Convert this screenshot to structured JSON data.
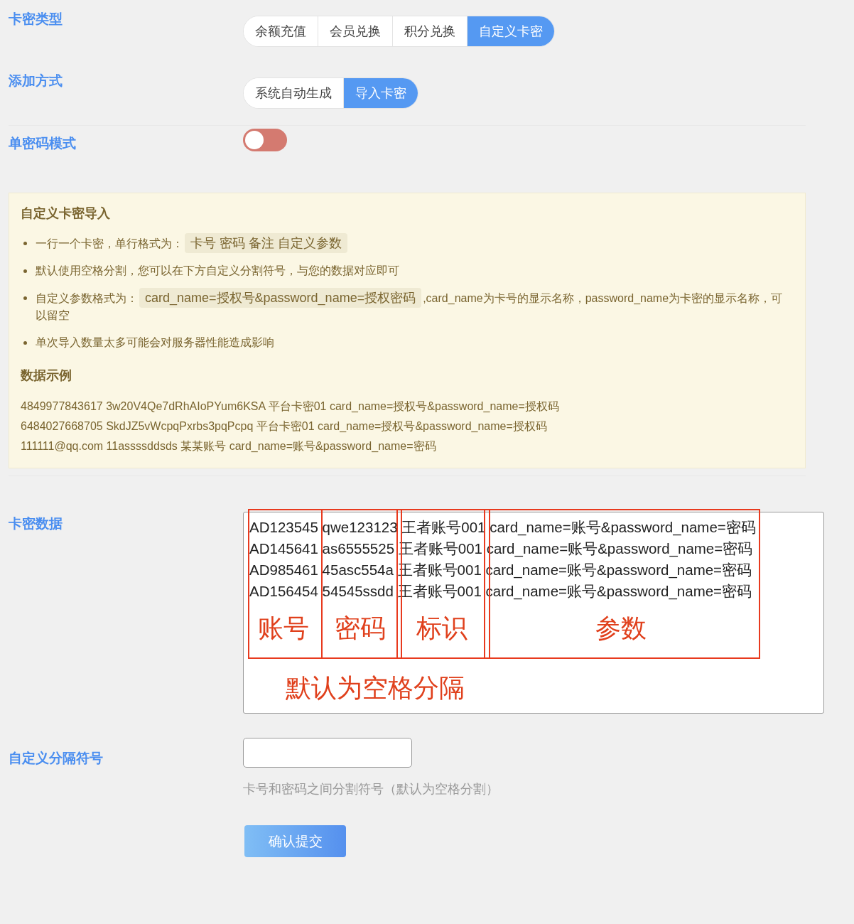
{
  "card_type": {
    "label": "卡密类型",
    "options": [
      {
        "label": "余额充值",
        "selected": false
      },
      {
        "label": "会员兑换",
        "selected": false
      },
      {
        "label": "积分兑换",
        "selected": false
      },
      {
        "label": "自定义卡密",
        "selected": true
      }
    ]
  },
  "add_method": {
    "label": "添加方式",
    "options": [
      {
        "label": "系统自动生成",
        "selected": false
      },
      {
        "label": "导入卡密",
        "selected": true
      }
    ]
  },
  "single_password_mode": {
    "label": "单密码模式",
    "on": false
  },
  "tips": {
    "title": "自定义卡密导入",
    "items": [
      [
        {
          "kind": "text",
          "text": "一行一个卡密，单行格式为："
        },
        {
          "kind": "code",
          "text": "卡号  密码  备注  自定义参数"
        }
      ],
      [
        {
          "kind": "text",
          "text": "默认使用空格分割，您可以在下方自定义分割符号，与您的数据对应即可"
        }
      ],
      [
        {
          "kind": "text",
          "text": "自定义参数格式为："
        },
        {
          "kind": "code",
          "text": "card_name=授权号&password_name=授权密码"
        },
        {
          "kind": "text",
          "text": ",card_name为卡号的显示名称，password_name为卡密的显示名称，可以留空"
        }
      ],
      [
        {
          "kind": "text",
          "text": "单次导入数量太多可能会对服务器性能造成影响"
        }
      ]
    ],
    "example_title": "数据示例",
    "examples": [
      "4849977843617 3w20V4Qe7dRhAIoPYum6KSA 平台卡密01 card_name=授权号&password_name=授权码",
      "6484027668705 SkdJZ5vWcpqPxrbs3pqPcpq 平台卡密01 card_name=授权号&password_name=授权码",
      "111111@qq.com 11assssddsds 某某账号 card_name=账号&password_name=密码"
    ]
  },
  "card_data": {
    "label": "卡密数据",
    "lines": [
      "AD123545 qwe123123 王者账号001 card_name=账号&password_name=密码",
      "AD145641 as6555525 王者账号001 card_name=账号&password_name=密码",
      "AD985461 45asc554a 王者账号001 card_name=账号&password_name=密码",
      "AD156454 54545ssdd 王者账号001 card_name=账号&password_name=密码"
    ],
    "annotations": [
      {
        "label": "账号"
      },
      {
        "label": "密码"
      },
      {
        "label": "标识"
      },
      {
        "label": "参数"
      }
    ],
    "note": "默认为空格分隔"
  },
  "separator": {
    "label": "自定义分隔符号",
    "hint": "卡号和密码之间分割符号（默认为空格分割）"
  },
  "submit": {
    "label": "确认提交"
  }
}
